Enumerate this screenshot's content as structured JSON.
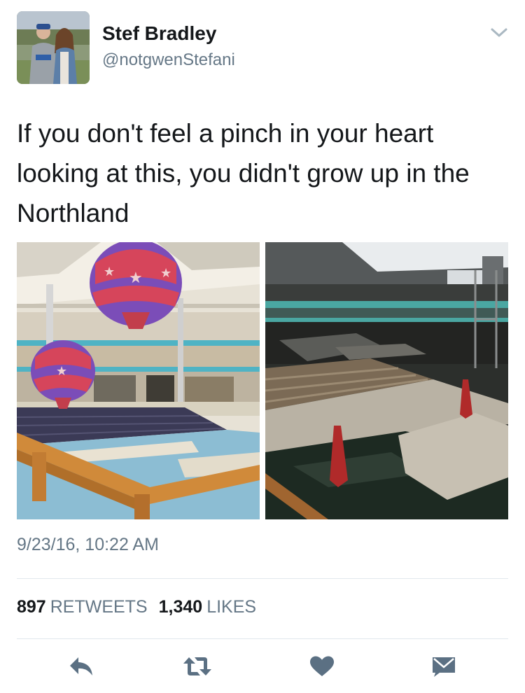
{
  "user": {
    "display_name": "Stef Bradley",
    "handle": "@notgwenStefani"
  },
  "tweet": {
    "text": "If you don't feel a pinch in your heart looking at this, you didn't grow up in the Northland",
    "timestamp": "9/23/16, 10:22 AM"
  },
  "stats": {
    "retweets_count": "897",
    "retweets_label": "RETWEETS",
    "likes_count": "1,340",
    "likes_label": "LIKES"
  },
  "actions": [
    "reply-icon",
    "retweet-icon",
    "like-heart-icon",
    "direct-message-icon"
  ],
  "colors": {
    "text": "#14171a",
    "secondary": "#657786",
    "icon": "#5b7083",
    "divider": "#e1e8ed"
  }
}
